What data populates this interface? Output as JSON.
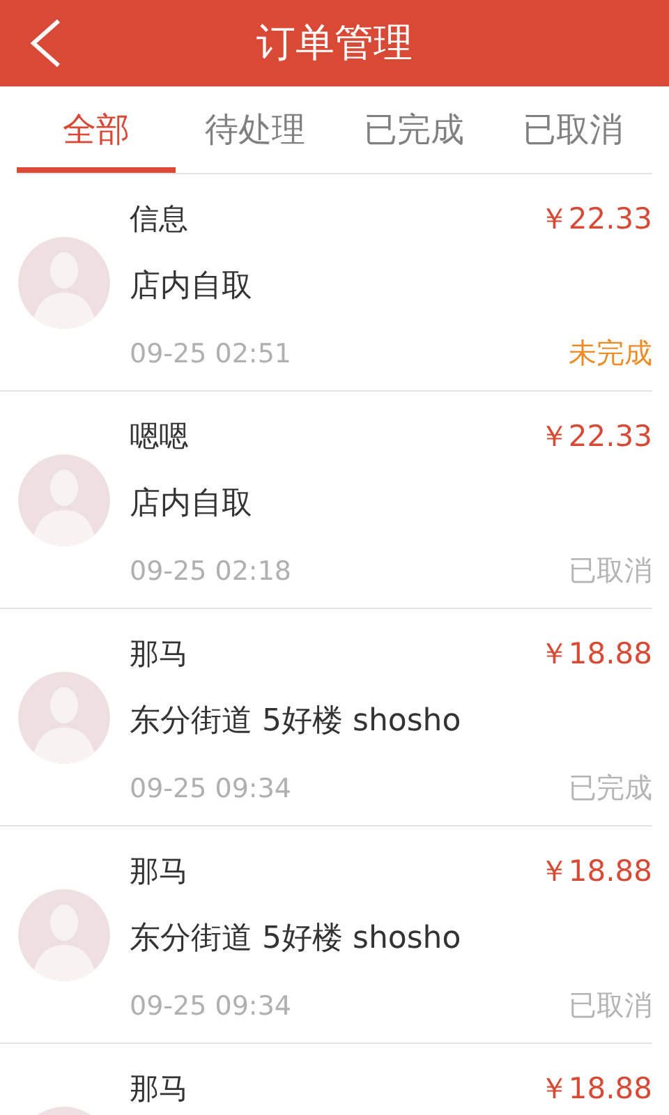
{
  "header": {
    "title": "订单管理"
  },
  "tabs": [
    {
      "label": "全部",
      "selected": true
    },
    {
      "label": "待处理",
      "selected": false
    },
    {
      "label": "已完成",
      "selected": false
    },
    {
      "label": "已取消",
      "selected": false
    }
  ],
  "orders": [
    {
      "name": "信息",
      "price": "￥22.33",
      "address": "店内自取",
      "time": "09-25 02:51",
      "status": "未完成",
      "color": "#f08a24"
    },
    {
      "name": "嗯嗯",
      "price": "￥22.33",
      "address": "店内自取",
      "time": "09-25 02:18",
      "status": "已取消",
      "color": "#b4b4b4"
    },
    {
      "name": "那马",
      "price": "￥18.88",
      "address": "东分街道 5好楼 shosho",
      "time": "09-25 09:34",
      "status": "已完成",
      "color": "#b4b4b4"
    },
    {
      "name": "那马",
      "price": "￥18.88",
      "address": "东分街道 5好楼 shosho",
      "time": "09-25 09:34",
      "status": "已取消",
      "color": "#b4b4b4"
    },
    {
      "name": "那马",
      "price": "￥18.88"
    }
  ]
}
